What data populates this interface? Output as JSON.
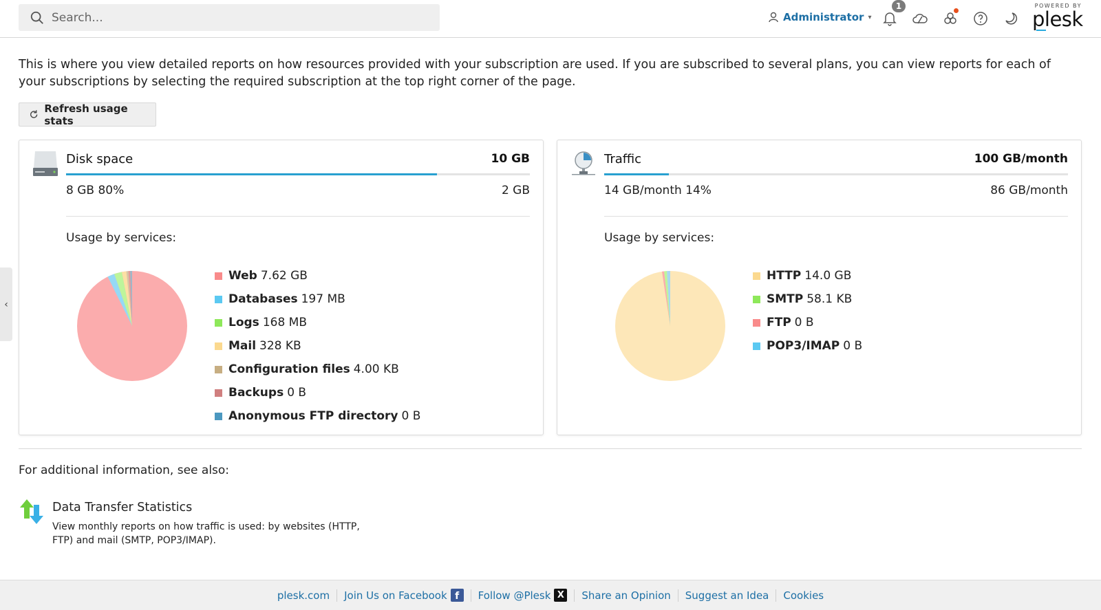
{
  "header": {
    "search_placeholder": "Search...",
    "user_label": "Administrator",
    "notifications_count": "1",
    "logo_powered_by": "POWERED BY",
    "logo_text": "plesk"
  },
  "intro_text": "This is where you view detailed reports on how resources provided with your subscription are used. If you are subscribed to several plans, you can view reports for each of your subscriptions by selecting the required subscription at the top right corner of the page.",
  "refresh_label": "Refresh usage stats",
  "disk": {
    "title": "Disk space",
    "limit": "10 GB",
    "used_label": "8 GB 80%",
    "remaining_label": "2 GB",
    "usage_fraction": 0.8,
    "usage_by_services_label": "Usage by services:",
    "legend": [
      {
        "name": "Web",
        "value": "7.62 GB",
        "color": "#f98b8b"
      },
      {
        "name": "Databases",
        "value": "197 MB",
        "color": "#5bc9f2"
      },
      {
        "name": "Logs",
        "value": "168 MB",
        "color": "#8ee85a"
      },
      {
        "name": "Mail",
        "value": "328 KB",
        "color": "#fbd98f"
      },
      {
        "name": "Configuration files",
        "value": "4.00 KB",
        "color": "#c7ae82"
      },
      {
        "name": "Backups",
        "value": "0 B",
        "color": "#d07f7f"
      },
      {
        "name": "Anonymous FTP directory",
        "value": "0 B",
        "color": "#4b98c0"
      }
    ]
  },
  "traffic": {
    "title": "Traffic",
    "limit": "100 GB/month",
    "used_label": "14 GB/month 14%",
    "remaining_label": "86 GB/month",
    "usage_fraction": 0.14,
    "usage_by_services_label": "Usage by services:",
    "legend": [
      {
        "name": "HTTP",
        "value": "14.0 GB",
        "color": "#fbd98f"
      },
      {
        "name": "SMTP",
        "value": "58.1 KB",
        "color": "#8ee85a"
      },
      {
        "name": "FTP",
        "value": "0 B",
        "color": "#f98b8b"
      },
      {
        "name": "POP3/IMAP",
        "value": "0 B",
        "color": "#5bc9f2"
      }
    ]
  },
  "additional": {
    "heading": "For additional information, see also:",
    "link_title": "Data Transfer Statistics",
    "link_description": "View monthly reports on how traffic is used: by websites (HTTP, FTP) and mail (SMTP, POP3/IMAP)."
  },
  "footer": {
    "links": [
      "plesk.com",
      "Join Us on Facebook",
      "Follow @Plesk",
      "Share an Opinion",
      "Suggest an Idea",
      "Cookies"
    ]
  }
}
